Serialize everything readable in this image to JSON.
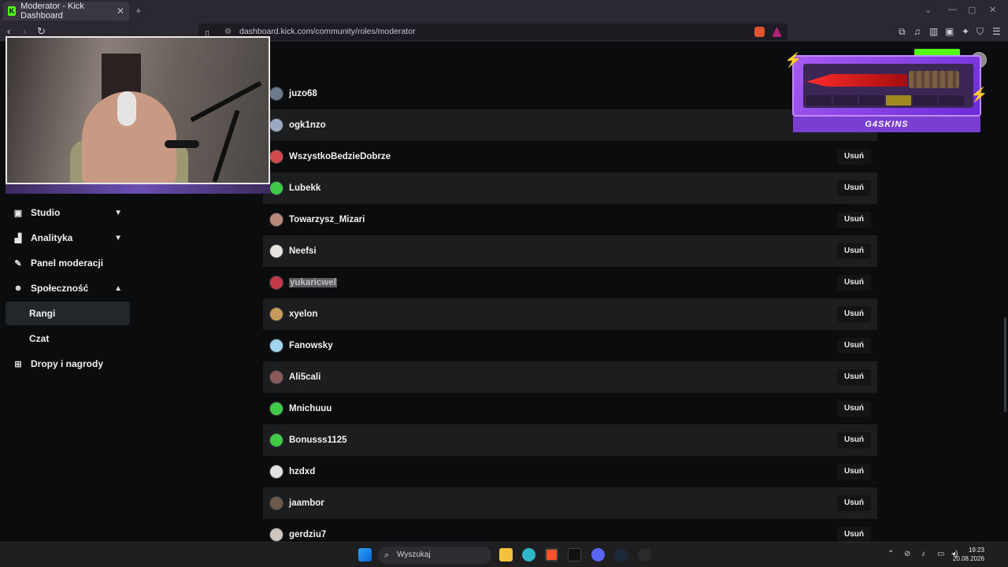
{
  "browser": {
    "tab_title": "Moderator - Kick Dashboard",
    "tab_favicon": "K",
    "url": "dashboard.kick.com/community/roles/moderator"
  },
  "sidebar": {
    "items": [
      {
        "label": "Studio",
        "icon": "studio-icon",
        "chevron": "down"
      },
      {
        "label": "Analityka",
        "icon": "chart-icon",
        "chevron": "down"
      },
      {
        "label": "Panel moderacji",
        "icon": "wrench-icon"
      },
      {
        "label": "Społeczność",
        "icon": "community-icon",
        "chevron": "up"
      },
      {
        "label": "Rangi",
        "sub": true,
        "active": true
      },
      {
        "label": "Czat",
        "sub": true
      },
      {
        "label": "Dropy i nagrody",
        "icon": "gift-icon"
      }
    ]
  },
  "moderators": {
    "remove_label": "Usuń",
    "rows": [
      {
        "name": "juzo68",
        "avatar_color": "#6b7a8c",
        "show_remove": false
      },
      {
        "name": "ogk1nzo",
        "avatar_color": "#9aa8c2",
        "show_remove": false
      },
      {
        "name": "WszystkoBedzieDobrze",
        "avatar_color": "#d34a4a",
        "show_remove": true
      },
      {
        "name": "Lubekk",
        "avatar_color": "#41c94a",
        "show_remove": true
      },
      {
        "name": "Towarzysz_Mizari",
        "avatar_color": "#b98a7a",
        "show_remove": true
      },
      {
        "name": "Neefsi",
        "avatar_color": "#e8e4e0",
        "show_remove": true
      },
      {
        "name": "yukaricwel",
        "avatar_color": "#c23a4a",
        "show_remove": true,
        "highlighted": true
      },
      {
        "name": "xyelon",
        "avatar_color": "#c69a5a",
        "show_remove": true
      },
      {
        "name": "Fanowsky",
        "avatar_color": "#9fd6f0",
        "show_remove": true
      },
      {
        "name": "Ali5cali",
        "avatar_color": "#8a5a5a",
        "show_remove": true
      },
      {
        "name": "Mnichuuu",
        "avatar_color": "#41c94a",
        "show_remove": true
      },
      {
        "name": "Bonusss1125",
        "avatar_color": "#41c94a",
        "show_remove": true
      },
      {
        "name": "hzdxd",
        "avatar_color": "#e2e2e2",
        "show_remove": true
      },
      {
        "name": "jaambor",
        "avatar_color": "#6d5a4a",
        "show_remove": true
      },
      {
        "name": "gerdziu7",
        "avatar_color": "#cfc6bc",
        "show_remove": true
      }
    ]
  },
  "ad": {
    "brand": "G4SKINS"
  },
  "taskbar": {
    "search_placeholder": "Wyszukaj",
    "time": "19:23",
    "date": "20.08.2026"
  },
  "colors": {
    "accent": "#53fc18",
    "page_bg": "#0b0c0d",
    "row_alt": "#1b1d1f"
  }
}
